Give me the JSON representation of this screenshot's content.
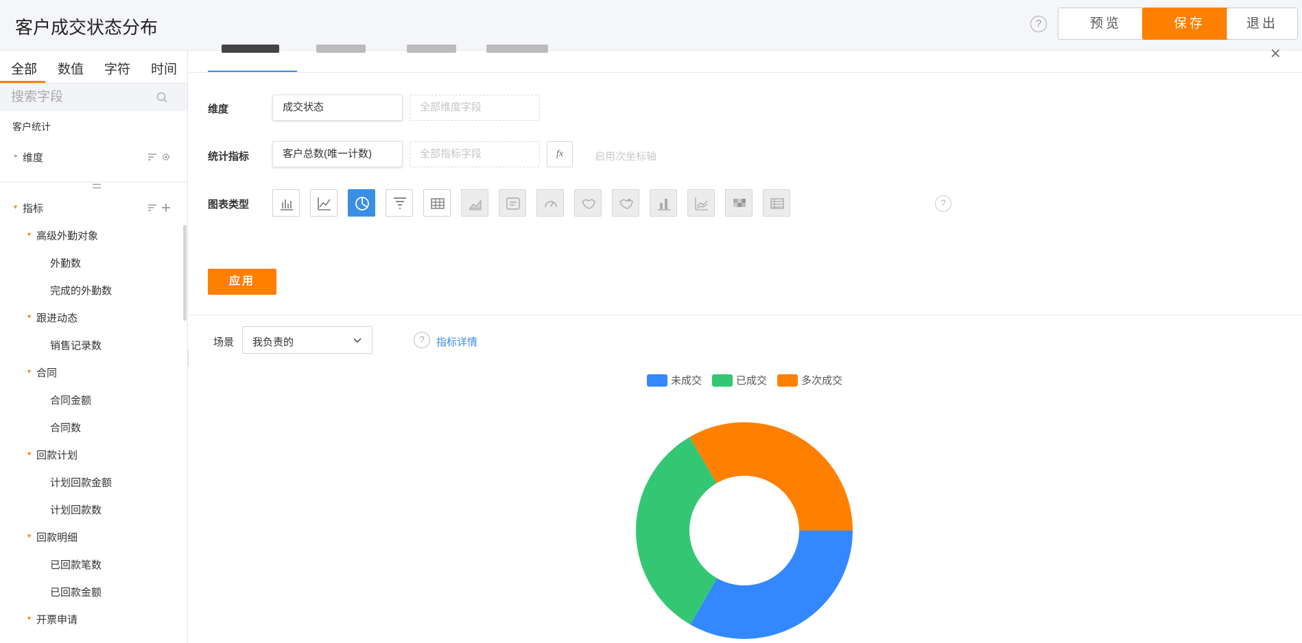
{
  "header": {
    "title": "客户成交状态分布",
    "help": "?",
    "preview_label": "预览",
    "save_label": "保存",
    "exit_label": "退出"
  },
  "sidebar": {
    "type_tabs": [
      "全部",
      "数值",
      "字符",
      "时间"
    ],
    "search_placeholder": "搜索字段",
    "section_title": "客户统计",
    "dimension_label": "维度",
    "metric_label": "指标",
    "tree": [
      {
        "label": "高级外勤对象",
        "children": [
          "外勤数",
          "完成的外勤数"
        ]
      },
      {
        "label": "跟进动态",
        "children": [
          "销售记录数"
        ]
      },
      {
        "label": "合同",
        "children": [
          "合同金额",
          "合同数"
        ]
      },
      {
        "label": "回款计划",
        "children": [
          "计划回款金额",
          "计划回款数"
        ]
      },
      {
        "label": "回款明细",
        "children": [
          "已回款笔数",
          "已回款金额"
        ]
      },
      {
        "label": "开票申请",
        "children": []
      }
    ]
  },
  "config": {
    "dimension_label": "维度",
    "dimension_value": "成交状态",
    "dimension_placeholder": "全部维度字段",
    "metric_label": "统计指标",
    "metric_value": "客户总数(唯一计数)",
    "metric_placeholder": "全部指标字段",
    "fx_label": "fx",
    "secondary_axis_label": "启用次坐标轴",
    "chart_type_label": "图表类型",
    "chart_types": [
      {
        "icon": "bar-chart-icon",
        "state": "normal"
      },
      {
        "icon": "line-chart-icon",
        "state": "normal"
      },
      {
        "icon": "pie-chart-icon",
        "state": "active"
      },
      {
        "icon": "funnel-chart-icon",
        "state": "normal"
      },
      {
        "icon": "table-icon",
        "state": "normal"
      },
      {
        "icon": "area-chart-icon",
        "state": "disabled"
      },
      {
        "icon": "text-card-icon",
        "state": "disabled"
      },
      {
        "icon": "gauge-icon",
        "state": "disabled"
      },
      {
        "icon": "map-icon",
        "state": "disabled"
      },
      {
        "icon": "map-point-icon",
        "state": "disabled"
      },
      {
        "icon": "stacked-bar-icon",
        "state": "disabled"
      },
      {
        "icon": "multi-line-icon",
        "state": "disabled"
      },
      {
        "icon": "heatmap-icon",
        "state": "disabled"
      },
      {
        "icon": "pivot-table-icon",
        "state": "disabled"
      }
    ],
    "chart_type_help": "?",
    "apply_label": "应用"
  },
  "preview": {
    "scene_label": "场景",
    "scene_value": "我负责的",
    "detail_help": "?",
    "detail_link": "指标详情"
  },
  "colors": {
    "accent_orange": "#ff7f00",
    "accent_blue": "#3a8ee6"
  },
  "chart_data": {
    "type": "pie",
    "donut": true,
    "categories": [
      "未成交",
      "已成交",
      "多次成交"
    ],
    "values": [
      33.3,
      33.3,
      33.4
    ],
    "colors": [
      "#3388ff",
      "#33c774",
      "#ff8000"
    ],
    "legend": "top-center",
    "title": ""
  }
}
